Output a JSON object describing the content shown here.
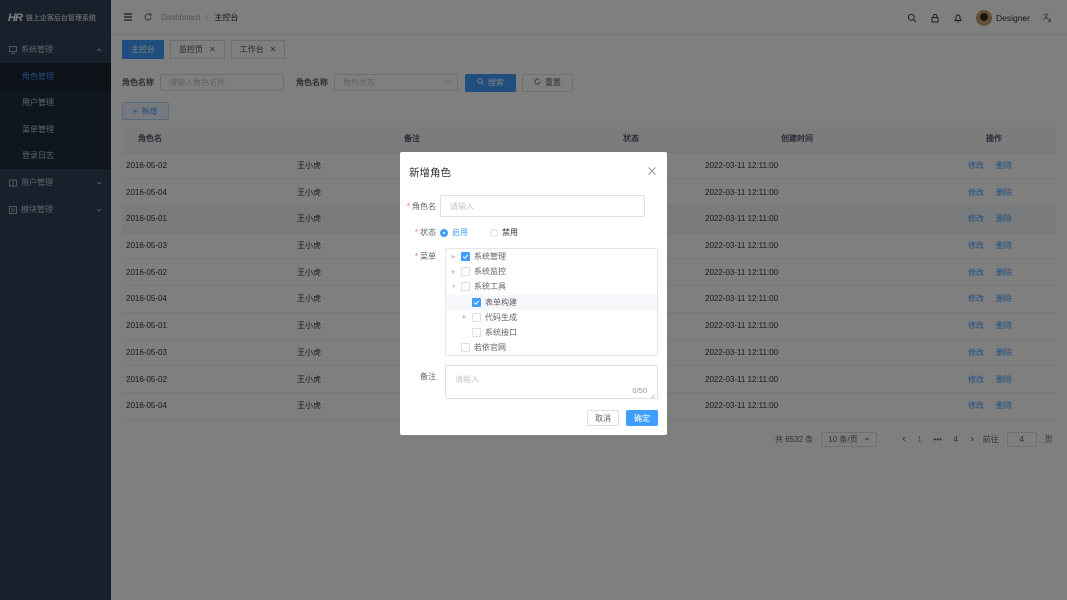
{
  "app": {
    "logo_mark": "HR",
    "title": "链上企客后台管理系统"
  },
  "sidebar": {
    "groups": [
      {
        "label": "系统管理",
        "icon": "monitor-icon",
        "expanded": true,
        "items": [
          {
            "label": "角色管理",
            "active": true
          },
          {
            "label": "用户管理"
          },
          {
            "label": "菜单管理"
          },
          {
            "label": "登录日志"
          }
        ]
      },
      {
        "label": "用户管理",
        "icon": "book-icon",
        "expanded": false
      },
      {
        "label": "模块管理",
        "icon": "list-icon",
        "expanded": false
      }
    ]
  },
  "header": {
    "breadcrumb": [
      "Dashboard",
      "主控台"
    ],
    "user_name": "Designer"
  },
  "tags": [
    {
      "label": "主控台",
      "active": true
    },
    {
      "label": "监控页",
      "closable": true
    },
    {
      "label": "工作台",
      "closable": true
    }
  ],
  "search": {
    "role_name_label": "角色名称",
    "role_name_placeholder": "请输入角色名称",
    "status_label": "角色名称",
    "status_placeholder": "角色状态",
    "search_label": "搜索",
    "reset_label": "重置",
    "add_label": "新增"
  },
  "table": {
    "headers": [
      "角色名",
      "备注",
      "状态",
      "创建时间",
      "操作"
    ],
    "rows": [
      {
        "name": "2016-05-02",
        "remark": "王小虎",
        "time": "2022-03-11  12:11:00"
      },
      {
        "name": "2016-05-04",
        "remark": "王小虎",
        "time": "2022-03-11  12:11:00"
      },
      {
        "name": "2016-05-01",
        "remark": "王小虎",
        "time": "2022-03-11  12:11:00"
      },
      {
        "name": "2016-05-03",
        "remark": "王小虎",
        "time": "2022-03-11  12:11:00"
      },
      {
        "name": "2016-05-02",
        "remark": "王小虎",
        "time": "2022-03-11  12:11:00"
      },
      {
        "name": "2016-05-04",
        "remark": "王小虎",
        "time": "2022-03-11  12:11:00"
      },
      {
        "name": "2016-05-01",
        "remark": "王小虎",
        "time": "2022-03-11  12:11:00"
      },
      {
        "name": "2016-05-03",
        "remark": "王小虎",
        "time": "2022-03-11  12:11:00"
      },
      {
        "name": "2016-05-02",
        "remark": "王小虎",
        "time": "2022-03-11  12:11:00"
      },
      {
        "name": "2016-05-04",
        "remark": "王小虎",
        "time": "2022-03-11  12:11:00"
      }
    ],
    "edit_label": "修改",
    "delete_label": "删除"
  },
  "pager": {
    "total": "共 6532 条",
    "size": "10 条/页",
    "pages": [
      "1",
      "•••",
      "4"
    ],
    "goto_label": "前往",
    "goto_value": "4",
    "page_suffix": "页"
  },
  "dialog": {
    "title": "新增角色",
    "name_label": "角色名",
    "name_placeholder": "请输入",
    "status_label": "状态",
    "status_options": [
      "启用",
      "禁用"
    ],
    "menu_label": "菜单",
    "tree": [
      {
        "label": "系统管理",
        "checked": true,
        "caret": "right",
        "indent": 0
      },
      {
        "label": "系统监控",
        "checked": false,
        "caret": "right",
        "indent": 0
      },
      {
        "label": "系统工具",
        "checked": false,
        "caret": "down",
        "indent": 0
      },
      {
        "label": "表单构建",
        "checked": true,
        "caret": "none",
        "indent": 1,
        "highlight": true
      },
      {
        "label": "代码生成",
        "checked": false,
        "caret": "right",
        "indent": 1
      },
      {
        "label": "系统接口",
        "checked": false,
        "caret": "none",
        "indent": 1
      },
      {
        "label": "若依官网",
        "checked": false,
        "caret": "none",
        "indent": 0
      }
    ],
    "remark_label": "备注",
    "remark_placeholder": "请输入",
    "remark_count": "0/50",
    "cancel_label": "取消",
    "confirm_label": "确定"
  },
  "colors": {
    "primary": "#409eff",
    "sidebar": "#304156",
    "danger": "#f56c6c"
  }
}
